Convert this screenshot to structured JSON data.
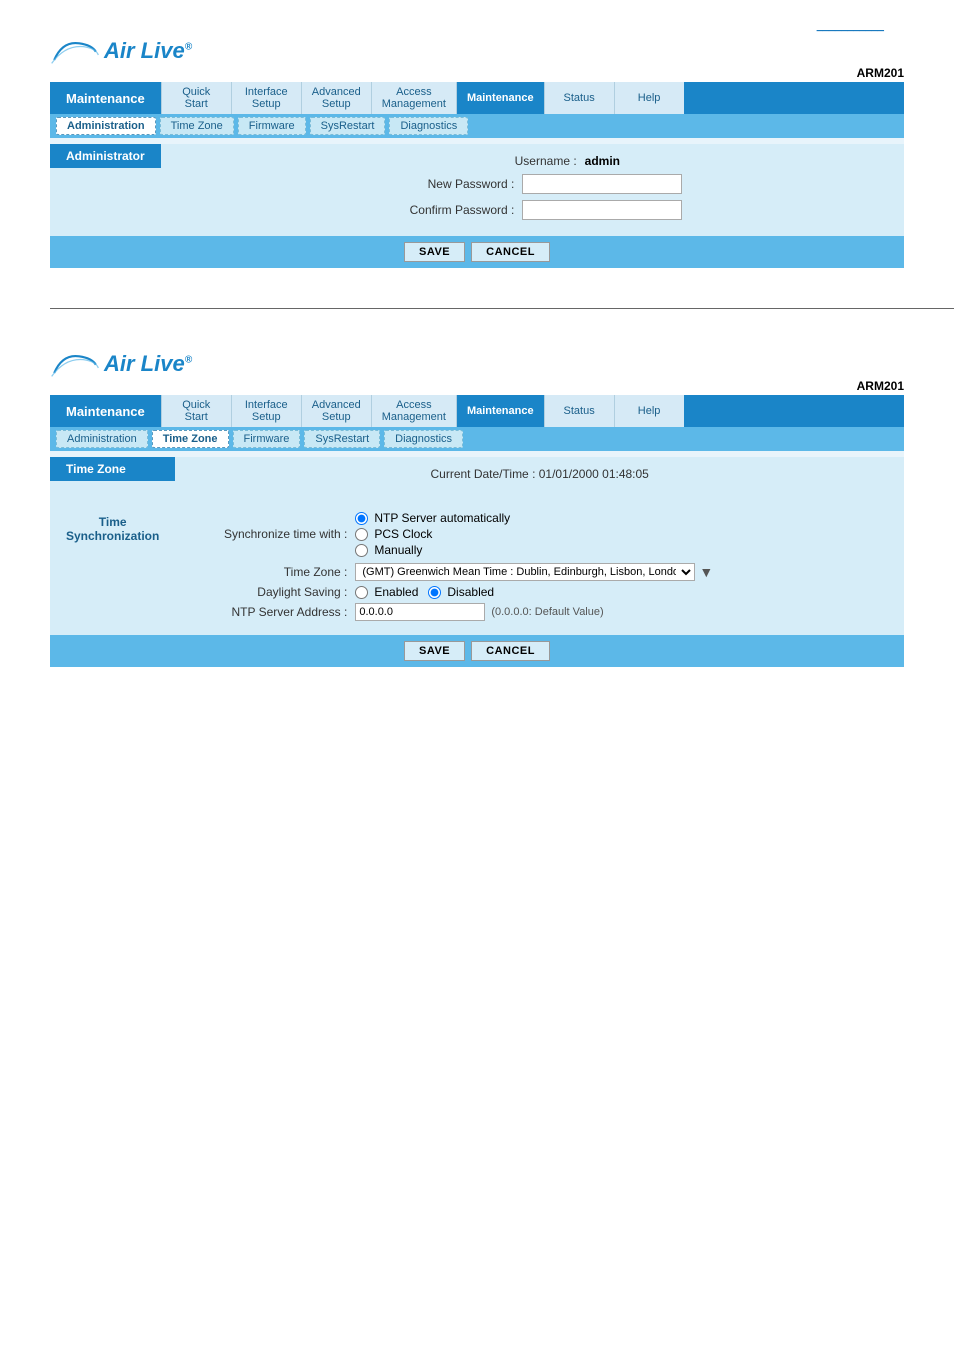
{
  "page": {
    "title": "ARM201",
    "top_link": "___________"
  },
  "logo": {
    "text": "Air Live",
    "registered": "®"
  },
  "nav": {
    "current": "Maintenance",
    "items": [
      {
        "id": "quick-start",
        "label_line1": "Quick",
        "label_line2": "Start"
      },
      {
        "id": "interface-setup",
        "label_line1": "Interface",
        "label_line2": "Setup"
      },
      {
        "id": "advanced-setup",
        "label_line1": "Advanced",
        "label_line2": "Setup"
      },
      {
        "id": "access-management",
        "label_line1": "Access",
        "label_line2": "Management"
      },
      {
        "id": "maintenance",
        "label_line1": "Maintenance",
        "label_line2": "",
        "active": true
      },
      {
        "id": "status",
        "label_line1": "Status",
        "label_line2": ""
      },
      {
        "id": "help",
        "label_line1": "Help",
        "label_line2": ""
      }
    ]
  },
  "section1": {
    "subnav": [
      {
        "id": "administration",
        "label": "Administration",
        "active": true
      },
      {
        "id": "time-zone",
        "label": "Time Zone"
      },
      {
        "id": "firmware",
        "label": "Firmware"
      },
      {
        "id": "sysrestart",
        "label": "SysRestart"
      },
      {
        "id": "diagnostics",
        "label": "Diagnostics"
      }
    ],
    "header": "Administrator",
    "username_label": "Username :",
    "username_value": "admin",
    "new_password_label": "New Password :",
    "confirm_password_label": "Confirm Password :",
    "new_password_value": "",
    "confirm_password_value": "",
    "save_label": "SAVE",
    "cancel_label": "CANCEL"
  },
  "section2": {
    "subnav": [
      {
        "id": "administration2",
        "label": "Administration"
      },
      {
        "id": "time-zone2",
        "label": "Time Zone",
        "active": true
      },
      {
        "id": "firmware2",
        "label": "Firmware"
      },
      {
        "id": "sysrestart2",
        "label": "SysRestart"
      },
      {
        "id": "diagnostics2",
        "label": "Diagnostics"
      }
    ],
    "header": "Time Zone",
    "current_datetime_label": "Current Date/Time :",
    "current_datetime_value": "01/01/2000 01:48:05",
    "time_sync_header": "Time Synchronization",
    "sync_label": "Synchronize time with :",
    "sync_options": [
      {
        "id": "ntp-auto",
        "label": "NTP Server automatically",
        "checked": true
      },
      {
        "id": "pcs-clock",
        "label": "PCS Clock",
        "checked": false
      },
      {
        "id": "manually",
        "label": "Manually",
        "checked": false
      }
    ],
    "timezone_label": "Time Zone :",
    "timezone_value": "(GMT) Greenwich Mean Time : Dublin, Edinburgh, Lisbon, London",
    "daylight_label": "Daylight Saving :",
    "daylight_options": [
      {
        "id": "enabled",
        "label": "Enabled",
        "checked": false
      },
      {
        "id": "disabled",
        "label": "Disabled",
        "checked": true
      }
    ],
    "ntp_label": "NTP Server Address :",
    "ntp_value": "0.0.0.0",
    "ntp_hint": "(0.0.0.0: Default Value)",
    "save_label": "SAVE",
    "cancel_label": "CANCEL"
  }
}
